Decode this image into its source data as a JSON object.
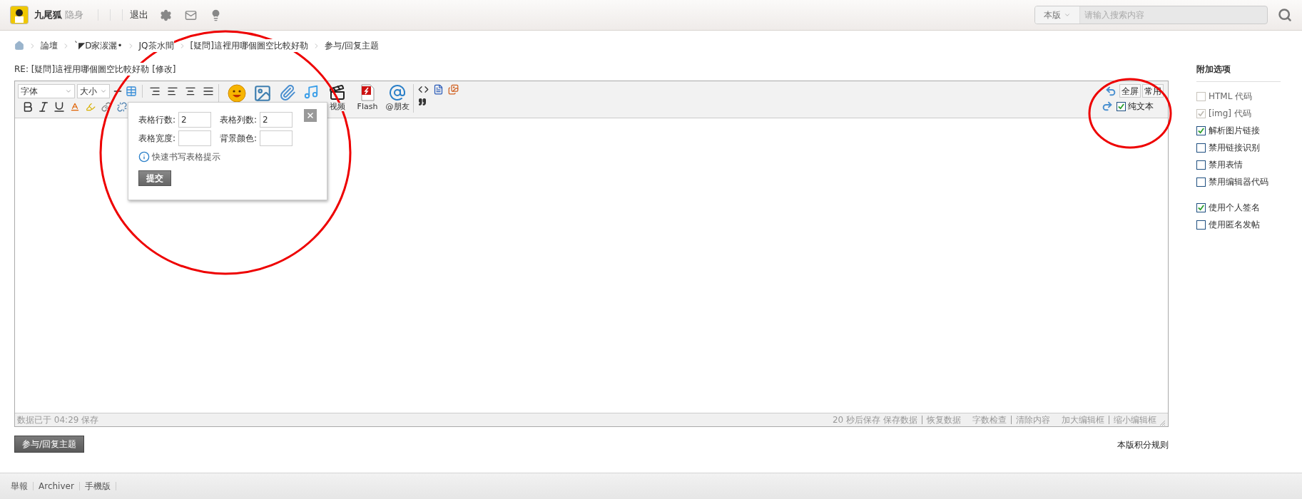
{
  "top_bar": {
    "user": {
      "name": "九尾狐",
      "status": "隐身"
    },
    "links": [
      "退出"
    ],
    "search": {
      "scope": "本版",
      "placeholder": "请输入搜索内容"
    }
  },
  "breadcrumb": [
    "論壇",
    "`◤D家湠灑•",
    "JQ茶水間",
    "[疑問]這裡用哪個圖空比較好勒",
    "参与/回复主题"
  ],
  "post_title": {
    "text": "RE: [疑問]這裡用哪個圖空比較好勒",
    "edit_link": "[修改]"
  },
  "editor": {
    "font_select": "字体",
    "size_select": "大小",
    "media_labels": [
      "视频",
      "Flash",
      "@朋友"
    ],
    "mode_buttons": [
      "全屏",
      "常用"
    ],
    "plain_text": {
      "label": "纯文本",
      "checked": true
    },
    "status_left": "数据已于 04:29 保存",
    "autosave": "20 秒后保存",
    "status_groups": [
      [
        "保存数据",
        "恢复数据"
      ],
      [
        "字数检查",
        "清除内容"
      ],
      [
        "加大编辑框",
        "缩小编辑框"
      ]
    ]
  },
  "table_popup": {
    "fields": [
      {
        "label": "表格行数:",
        "value": "2"
      },
      {
        "label": "表格列数:",
        "value": "2"
      },
      {
        "label": "表格宽度:"
      },
      {
        "label": "背景颜色:"
      }
    ],
    "hint": "快速书写表格提示",
    "submit": "提交"
  },
  "submit_button": "参与/回复主题",
  "rules_link": "本版积分规则",
  "options": {
    "title": "附加选项",
    "groups": [
      [
        {
          "label": "HTML 代码",
          "checked": false,
          "disabled": true
        },
        {
          "label": "[img] 代码",
          "checked": true,
          "disabled": true
        },
        {
          "label": "解析图片链接",
          "checked": true,
          "disabled": false
        },
        {
          "label": "禁用链接识别",
          "checked": false,
          "disabled": false
        },
        {
          "label": "禁用表情",
          "checked": false,
          "disabled": false
        },
        {
          "label": "禁用编辑器代码",
          "checked": false,
          "disabled": false
        }
      ],
      [
        {
          "label": "使用个人签名",
          "checked": true,
          "disabled": false
        },
        {
          "label": "使用匿名发帖",
          "checked": false,
          "disabled": false
        }
      ]
    ]
  },
  "footer": {
    "links": [
      "舉報",
      "Archiver",
      "手機版"
    ]
  }
}
